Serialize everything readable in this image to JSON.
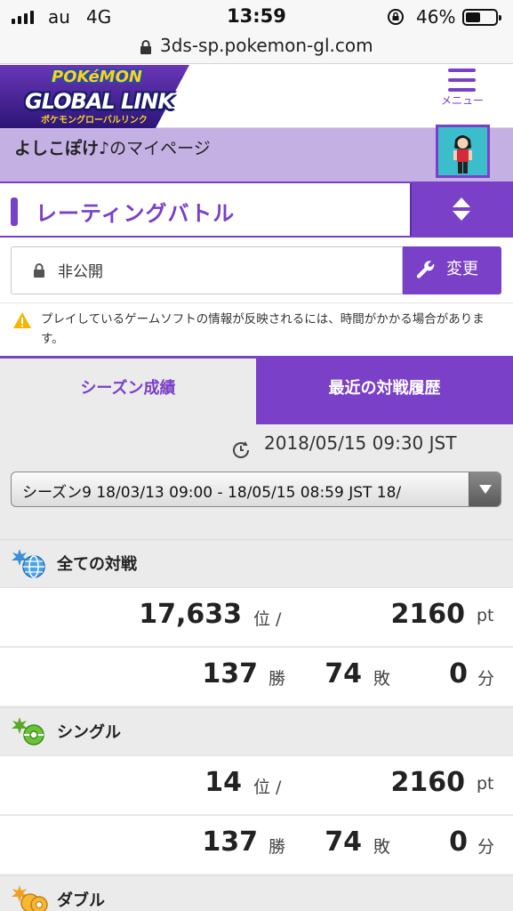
{
  "status_bar": {
    "carrier": "au",
    "network": "4G",
    "time": "13:59",
    "battery": "46%"
  },
  "url_bar": {
    "domain": "3ds-sp.pokemon-gl.com"
  },
  "header": {
    "logo_top": "POKéMON",
    "logo_main": "GLOBAL LINK",
    "logo_sub": "ポケモングローバルリンク",
    "menu_label": "メニュー"
  },
  "mypage": {
    "name": "よしこぽけ♪",
    "suffix": "のマイページ"
  },
  "rating": {
    "title": "レーティングバトル"
  },
  "privacy": {
    "status": "非公開",
    "change_label": "変更"
  },
  "notice": {
    "text": "プレイしているゲームソフトの情報が反映されるには、時間がかかる場合があります。"
  },
  "tabs": {
    "season": "シーズン成績",
    "recent": "最近の対戦履歴"
  },
  "updated": "2018/05/15 09:30 JST",
  "season_select": {
    "value": "シーズン9 18/03/13 09:00 - 18/05/15 08:59 JST 18/"
  },
  "sections": [
    {
      "label": "全ての対戦",
      "rank": "17,633",
      "rank_unit": "位 /",
      "points": "2160",
      "points_unit": "pt",
      "wins": "137",
      "wins_unit": "勝",
      "losses": "74",
      "losses_unit": "敗",
      "draws": "0",
      "draws_unit": "分"
    },
    {
      "label": "シングル",
      "rank": "14",
      "rank_unit": "位 /",
      "points": "2160",
      "points_unit": "pt",
      "wins": "137",
      "wins_unit": "勝",
      "losses": "74",
      "losses_unit": "敗",
      "draws": "0",
      "draws_unit": "分"
    },
    {
      "label": "ダブル"
    }
  ],
  "colors": {
    "accent": "#7a40c8",
    "accent_light": "#c5b0e4",
    "background": "#ebebeb"
  }
}
